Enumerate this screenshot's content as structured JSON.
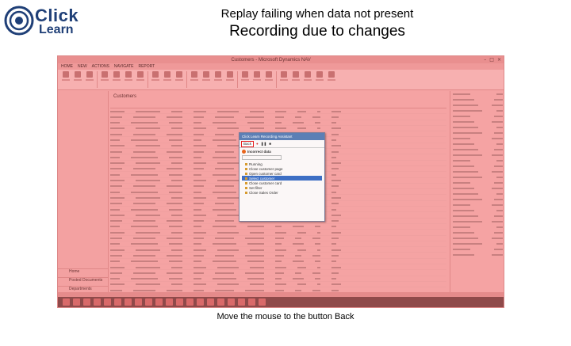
{
  "logo": {
    "line1": "Click",
    "line2": "Learn"
  },
  "slide": {
    "title": "Replay failing when data not present",
    "subtitle": "Recording due to changes",
    "caption": "Move the mouse to the button Back"
  },
  "app": {
    "title": "Customers - Microsoft Dynamics NAV",
    "tabs": [
      "HOME",
      "NEW",
      "ACTIONS",
      "NAVIGATE",
      "REPORT"
    ],
    "list_header": "Customers",
    "nav_bottom": [
      "Home",
      "Posted Documents",
      "Departments"
    ]
  },
  "dialog": {
    "title": "Click Learn Recording Assistant",
    "back_label": "Back",
    "warning": "Incorrect data",
    "tree_items": [
      "Running",
      "Close customer page",
      "Open customer card",
      "Select customer",
      "Close customer card",
      "Set filter",
      "Close Sales Order"
    ]
  },
  "colors": {
    "overlay": "#f5a3a3",
    "highlight": "#e61e1e",
    "logo": "#1f3f77"
  }
}
